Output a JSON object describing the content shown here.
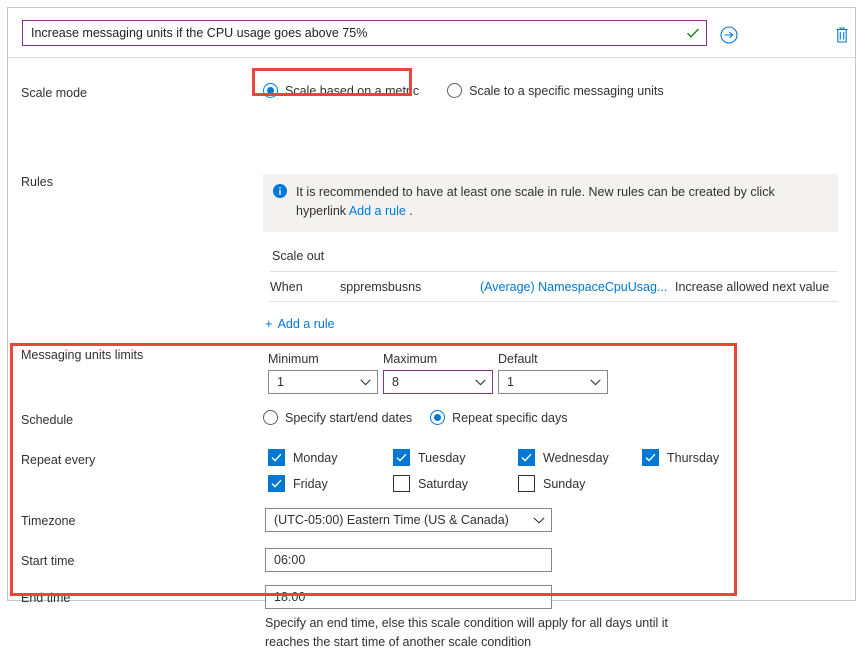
{
  "header": {
    "condition_name": "Increase messaging units if the CPU usage goes above 75%",
    "valid_icon": "check-icon",
    "run_icon": "arrow-right-circle-icon",
    "delete_icon": "trash-icon"
  },
  "scale_mode": {
    "label": "Scale mode",
    "options": [
      {
        "label": "Scale based on a metric",
        "selected": true
      },
      {
        "label": "Scale to a specific messaging units",
        "selected": false
      }
    ]
  },
  "rules": {
    "label": "Rules",
    "info_icon": "info-icon",
    "info_text_part1": "It is recommended to have at least one scale in rule. New rules can be created by click hyperlink ",
    "info_link": "Add a rule",
    "info_text_part2": " .",
    "section_title": "Scale out",
    "row": {
      "when": "When",
      "resource": "sppremsbusns",
      "metric": "(Average) NamespaceCpuUsag...",
      "action": "Increase allowed next value"
    },
    "add_rule_label": "Add a rule",
    "add_rule_plus": "+"
  },
  "messaging_units_limits": {
    "label": "Messaging units limits",
    "minimum": {
      "label": "Minimum",
      "value": "1"
    },
    "maximum": {
      "label": "Maximum",
      "value": "8"
    },
    "default": {
      "label": "Default",
      "value": "1"
    }
  },
  "schedule": {
    "label": "Schedule",
    "options": [
      {
        "label": "Specify start/end dates",
        "selected": false
      },
      {
        "label": "Repeat specific days",
        "selected": true
      }
    ]
  },
  "repeat_every": {
    "label": "Repeat every",
    "days": [
      {
        "label": "Monday",
        "checked": true
      },
      {
        "label": "Tuesday",
        "checked": true
      },
      {
        "label": "Wednesday",
        "checked": true
      },
      {
        "label": "Thursday",
        "checked": true
      },
      {
        "label": "Friday",
        "checked": true
      },
      {
        "label": "Saturday",
        "checked": false
      },
      {
        "label": "Sunday",
        "checked": false
      }
    ]
  },
  "timezone": {
    "label": "Timezone",
    "value": "(UTC-05:00) Eastern Time (US & Canada)"
  },
  "start_time": {
    "label": "Start time",
    "value": "06:00"
  },
  "end_time": {
    "label": "End time",
    "value": "18:00",
    "helper": "Specify an end time, else this scale condition will apply for all days until it reaches the start time of another scale condition"
  },
  "colors": {
    "accent_blue": "#0078d4",
    "focus_purple": "#8a2f8f",
    "valid_green": "#107c10",
    "annotation_red": "#e8453c",
    "info_bg": "#f3f2f1"
  }
}
